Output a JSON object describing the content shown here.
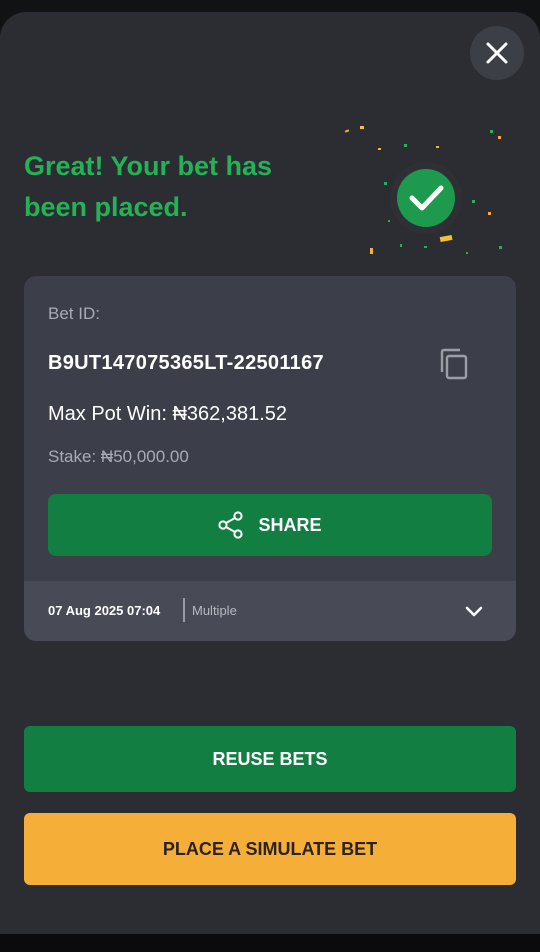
{
  "modal": {
    "headline": "Great! Your bet has been placed.",
    "close_icon": "close-icon",
    "success_icon": "check-circle-icon"
  },
  "bet": {
    "id_label": "Bet ID:",
    "id_value": "B9UT147075365LT-22501167",
    "max_pot_win": "Max Pot Win: ₦362,381.52",
    "stake": "Stake: ₦50,000.00",
    "share_label": "SHARE",
    "date": "07 Aug 2025 07:04",
    "type": "Multiple"
  },
  "actions": {
    "reuse_label": "REUSE BETS",
    "simulate_label": "PLACE A SIMULATE BET"
  },
  "colors": {
    "accent_green": "#137e42",
    "headline_green": "#24b256",
    "simulate_orange": "#f5ae38",
    "sheet_bg": "#2b2d32",
    "card_bg": "#3c3f4a"
  }
}
